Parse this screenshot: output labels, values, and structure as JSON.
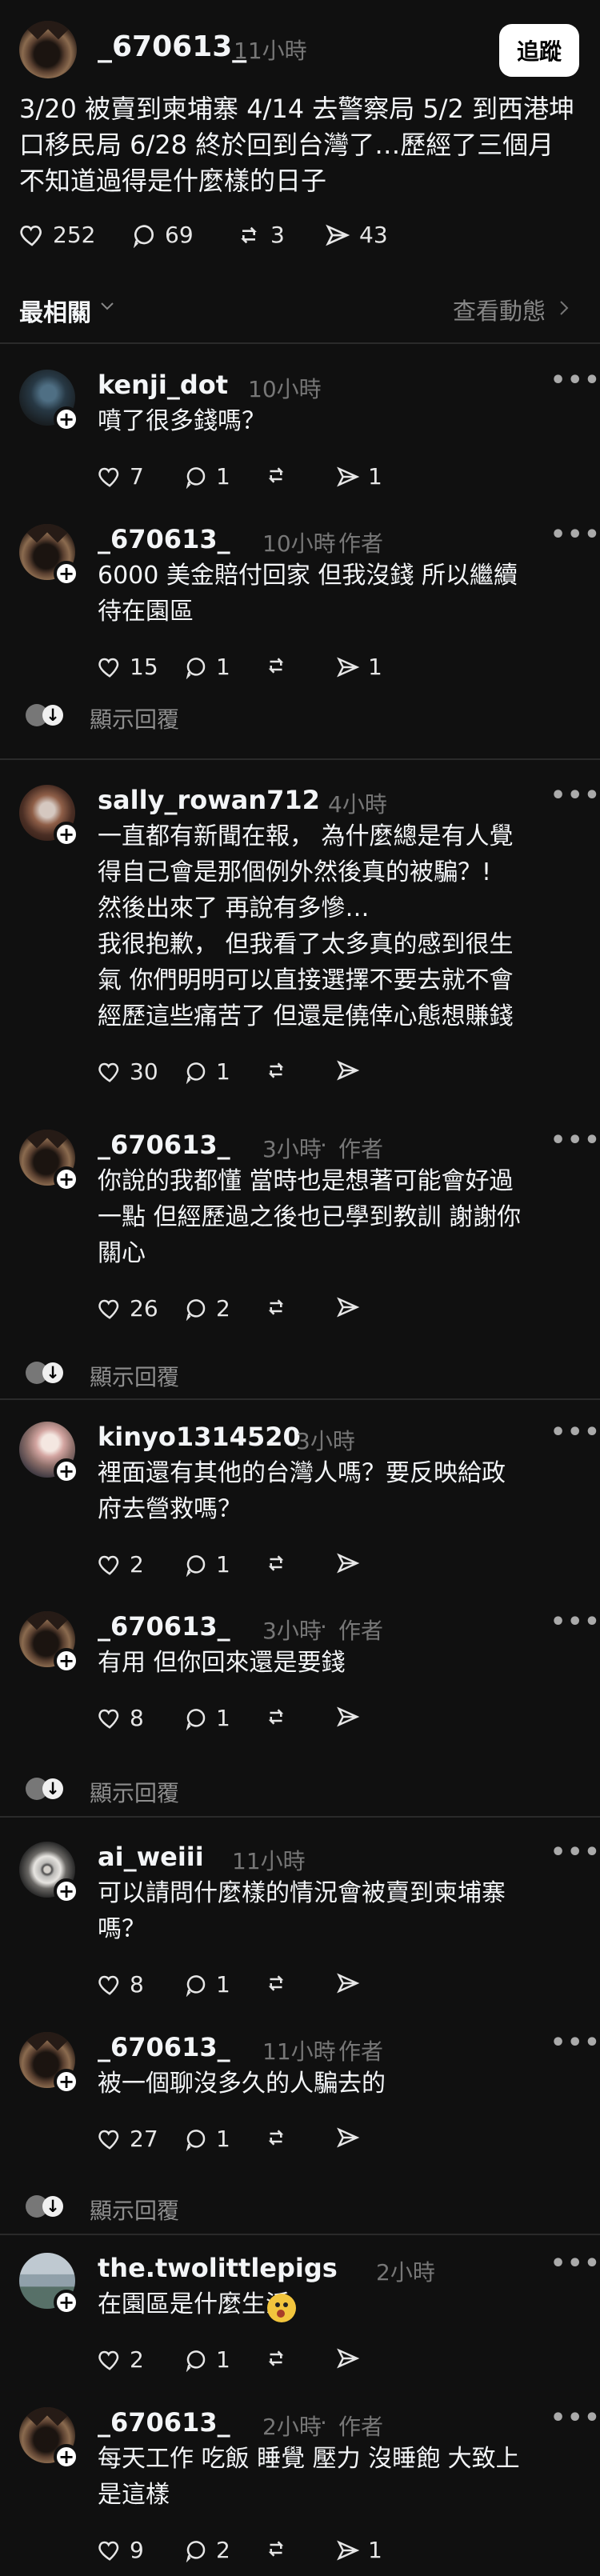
{
  "post": {
    "username": "_670613_",
    "time": "11小時",
    "follow_label": "追蹤",
    "text_lines": [
      "3/20 被賣到柬埔寨 4/14 去警察局 5/2 到西港坤",
      "口移民局 6/28 終於回到台灣了…歷經了三個月",
      "不知道過得是什麼樣的日子"
    ],
    "likes": "252",
    "comments": "69",
    "reposts": "3",
    "shares": "43"
  },
  "sort": {
    "label": "最相關",
    "view_activity": "查看動態"
  },
  "show_replies": "顯示回覆",
  "author_label": "作者",
  "threads": [
    {
      "comment": {
        "username": "kenji_dot",
        "time": "10小時",
        "lines": [
          "噴了很多錢嗎？"
        ],
        "likes": "7",
        "comments": "1",
        "reposts": "",
        "shares": "1"
      },
      "reply": {
        "username": "_670613_",
        "time": "10小時",
        "lines": [
          "6000 美金賠付回家 但我沒錢 所以繼續",
          "待在園區"
        ],
        "likes": "15",
        "comments": "1",
        "reposts": "",
        "shares": "1"
      }
    },
    {
      "comment": {
        "username": "sally_rowan712",
        "time": "4小時",
        "lines": [
          "一直都有新聞在報，  為什麼總是有人覺",
          "得自己會是那個例外然後真的被騙？!",
          "然後出來了 再說有多慘…",
          "我很抱歉，  但我看了太多真的感到很生",
          "氣  你們明明可以直接選擇不要去就不會",
          "經歷這些痛苦了 但還是僥倖心態想賺錢"
        ],
        "likes": "30",
        "comments": "1",
        "reposts": "",
        "shares": ""
      },
      "reply": {
        "username": "_670613_",
        "time": "3小時",
        "lines": [
          "你說的我都懂 當時也是想著可能會好過",
          "一點 但經歷過之後也已學到教訓 謝謝你",
          "關心"
        ],
        "likes": "26",
        "comments": "2",
        "reposts": "",
        "shares": ""
      }
    },
    {
      "comment": {
        "username": "kinyo1314520",
        "time": "3小時",
        "lines": [
          "裡面還有其他的台灣人嗎？要反映給政",
          "府去營救嗎？"
        ],
        "likes": "2",
        "comments": "1",
        "reposts": "",
        "shares": ""
      },
      "reply": {
        "username": "_670613_",
        "time": "3小時",
        "lines": [
          "有用 但你回來還是要錢"
        ],
        "likes": "8",
        "comments": "1",
        "reposts": "",
        "shares": ""
      }
    },
    {
      "comment": {
        "username": "ai_weiii",
        "time": "11小時",
        "lines": [
          "可以請問什麼樣的情況會被賣到柬埔寨",
          "嗎？"
        ],
        "likes": "8",
        "comments": "1",
        "reposts": "",
        "shares": ""
      },
      "reply": {
        "username": "_670613_",
        "time": "11小時",
        "lines": [
          "被一個聊沒多久的人騙去的"
        ],
        "likes": "27",
        "comments": "1",
        "reposts": "",
        "shares": ""
      }
    },
    {
      "comment": {
        "username": "the.twolittlepigs",
        "time": "2小時",
        "lines": [
          "在園區是什麼生活"
        ],
        "likes": "2",
        "comments": "1",
        "reposts": "",
        "shares": ""
      },
      "reply": {
        "username": "_670613_",
        "time": "2小時",
        "lines": [
          "每天工作 吃飯 睡覺 壓力 沒睡飽 大致上",
          "是這樣"
        ],
        "likes": "9",
        "comments": "2",
        "reposts": "",
        "shares": "1"
      }
    }
  ],
  "icons": {
    "heart": "heart-icon",
    "comment": "comment-icon",
    "repost": "repost-icon",
    "share": "share-icon",
    "more": "more-icon",
    "chevron": "chevron-down-icon"
  }
}
